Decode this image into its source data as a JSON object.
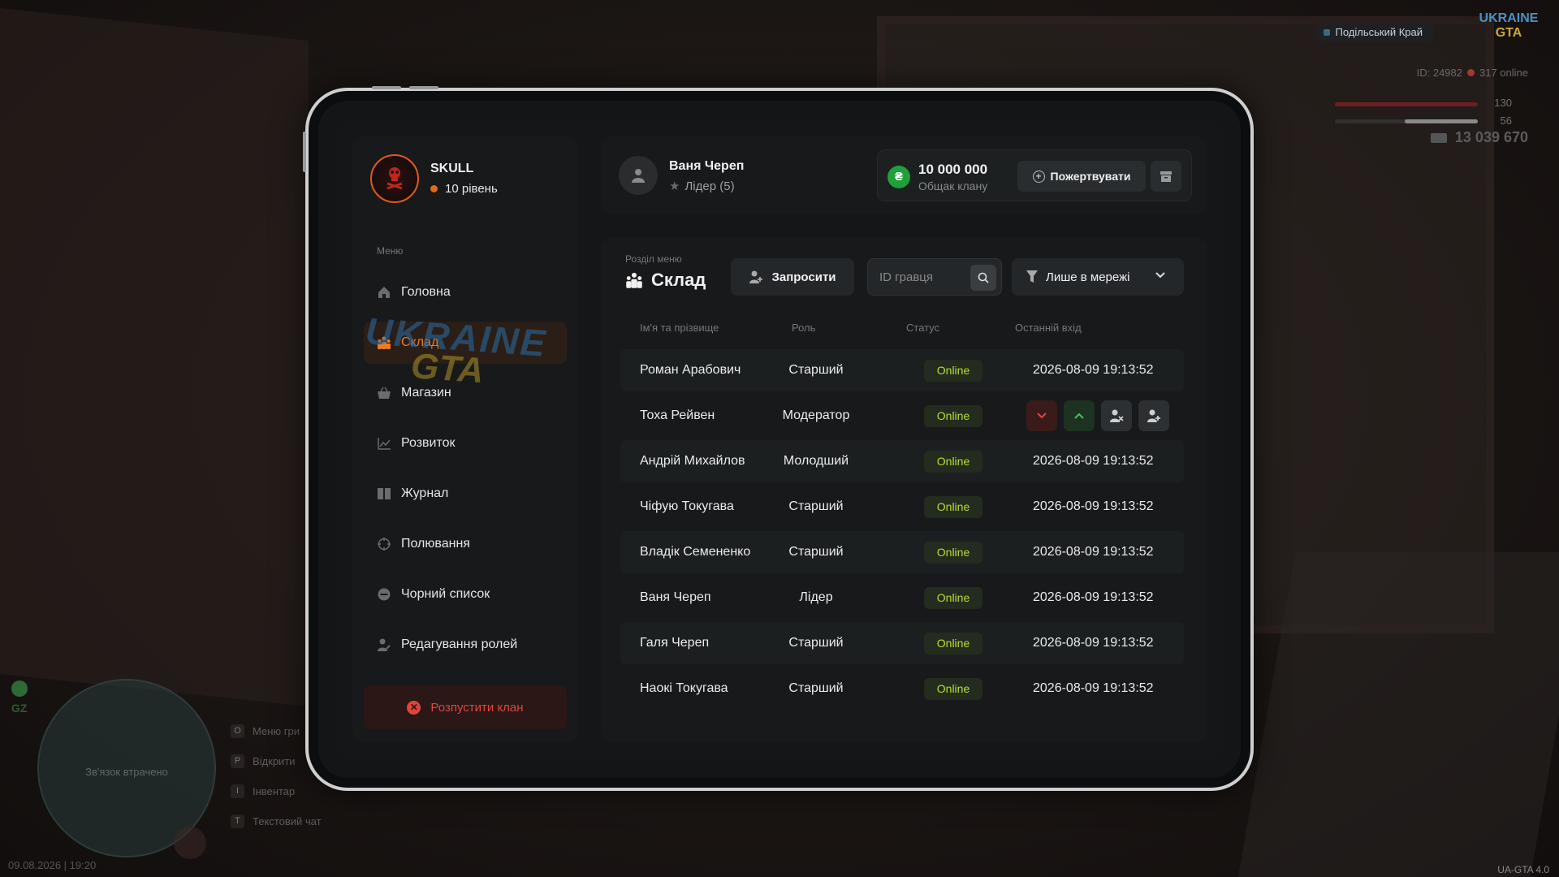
{
  "hud": {
    "server_name": "Подільський Край",
    "logo_top": "UKRAINE",
    "logo_bottom": "GTA",
    "player_id": "ID: 24982",
    "online_count": "317 online",
    "health": "130",
    "armor": "56",
    "money": "13 039 670",
    "minimap_status": "Зв'язок втрачено",
    "zone": "GZ",
    "hotkeys": [
      {
        "key": "O",
        "label": "Меню гри"
      },
      {
        "key": "P",
        "label": "Відкрити"
      },
      {
        "key": "I",
        "label": "Інвентар"
      },
      {
        "key": "T",
        "label": "Текстовий чат"
      }
    ],
    "datetime": "09.08.2026 | 19:20",
    "version": "UA-GTA 4.0",
    "colors": {
      "health": "#6e2020",
      "accent": "#f07a20",
      "online": "#b8e034",
      "danger": "#e0453c"
    }
  },
  "clan": {
    "name": "SKULL",
    "level": "10 рівень"
  },
  "menu": {
    "title": "Меню",
    "items": [
      {
        "label": "Головна",
        "icon": "home-icon"
      },
      {
        "label": "Склад",
        "icon": "members-icon",
        "active": true
      },
      {
        "label": "Магазин",
        "icon": "basket-icon"
      },
      {
        "label": "Розвиток",
        "icon": "chart-icon"
      },
      {
        "label": "Журнал",
        "icon": "book-icon"
      },
      {
        "label": "Полювання",
        "icon": "crosshair-icon"
      },
      {
        "label": "Чорний список",
        "icon": "ban-icon"
      },
      {
        "label": "Редагування ролей",
        "icon": "user-edit-icon"
      }
    ],
    "disband_label": "Розпустити клан"
  },
  "user": {
    "name": "Ваня Череп",
    "role": "Лідер (5)"
  },
  "balance": {
    "value": "10 000 000",
    "label": "Общак клану",
    "currency_symbol": "₴",
    "donate_label": "Пожертвувати"
  },
  "section": {
    "caption": "Розділ меню",
    "title": "Склад",
    "invite_label": "Запросити",
    "search_placeholder": "ID гравця",
    "filter_label": "Лише в мережі"
  },
  "table": {
    "headers": [
      "Ім'я та прізвище",
      "Роль",
      "Статус",
      "Останній вхід"
    ],
    "rows": [
      {
        "name": "Роман Арабович",
        "role": "Старший",
        "status": "Online",
        "last": "2026-08-09 19:13:52"
      },
      {
        "name": "Тоха Рейвен",
        "role": "Модератор",
        "status": "Online",
        "last": ""
      },
      {
        "name": "Андрій Михайлов",
        "role": "Молодший",
        "status": "Online",
        "last": "2026-08-09 19:13:52"
      },
      {
        "name": "Чіфую Токугава",
        "role": "Старший",
        "status": "Online",
        "last": "2026-08-09 19:13:52"
      },
      {
        "name": "Владік Семененко",
        "role": "Старший",
        "status": "Online",
        "last": "2026-08-09 19:13:52"
      },
      {
        "name": "Ваня Череп",
        "role": "Лідер",
        "status": "Online",
        "last": "2026-08-09 19:13:52"
      },
      {
        "name": "Галя Череп",
        "role": "Старший",
        "status": "Online",
        "last": "2026-08-09 19:13:52"
      },
      {
        "name": "Наокі Токугава",
        "role": "Старший",
        "status": "Online",
        "last": "2026-08-09 19:13:52"
      }
    ]
  },
  "watermark": {
    "line1": "UKRAINE",
    "line2": "GTA"
  }
}
